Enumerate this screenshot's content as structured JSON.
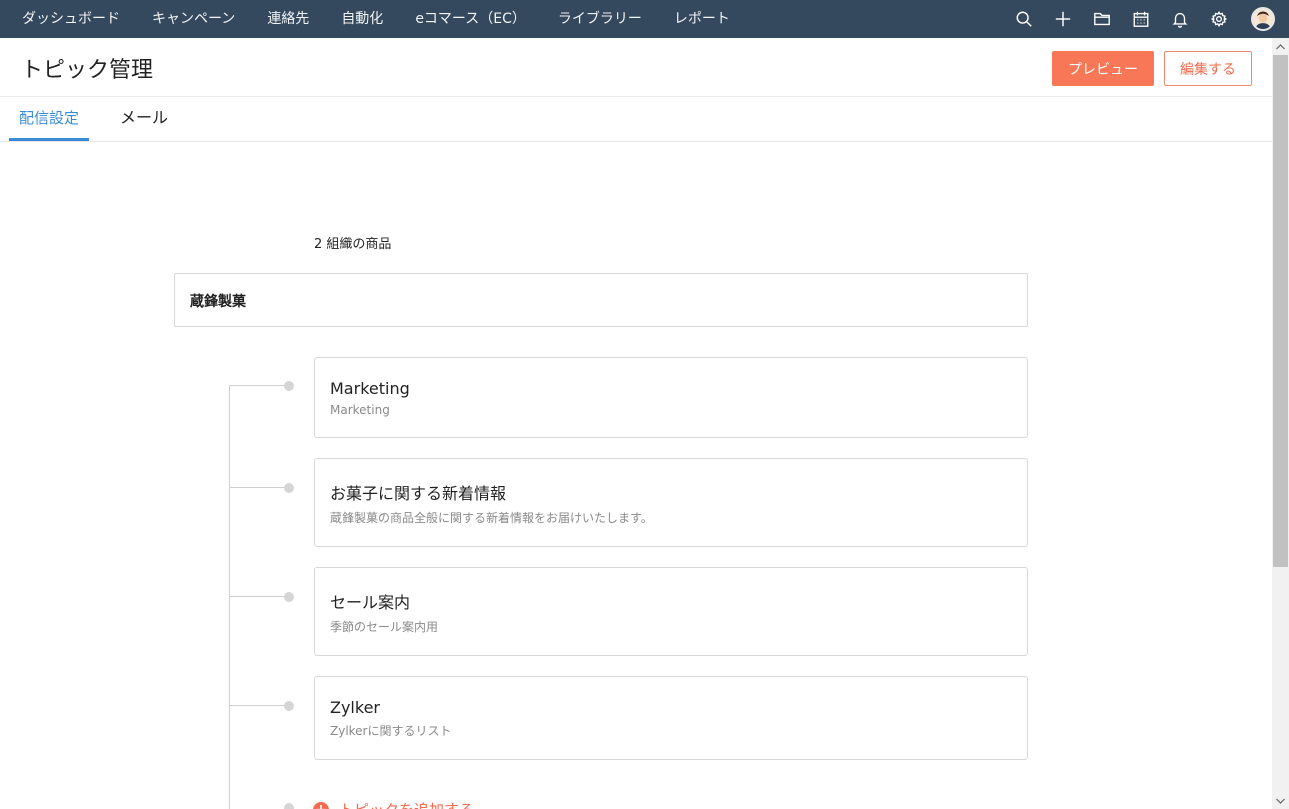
{
  "topnav": {
    "menu": [
      "ダッシュボード",
      "キャンペーン",
      "連絡先",
      "自動化",
      "eコマース（EC）",
      "ライブラリー",
      "レポート"
    ],
    "icons": [
      "search-icon",
      "plus-icon",
      "folder-icon",
      "calendar-icon",
      "bell-icon",
      "gear-icon"
    ]
  },
  "header": {
    "title": "トピック管理",
    "preview_label": "プレビュー",
    "edit_label": "編集する"
  },
  "tabs": [
    "配信設定",
    "メール"
  ],
  "content": {
    "org_count": "2 組織の商品",
    "org_name": "蔵鋒製菓",
    "topics": [
      {
        "name": "Marketing",
        "desc": "Marketing"
      },
      {
        "name": "お菓子に関する新着情報",
        "desc": "蔵鋒製菓の商品全般に関する新着情報をお届けいたします。"
      },
      {
        "name": "セール案内",
        "desc": "季節のセール案内用"
      },
      {
        "name": "Zylker",
        "desc": "Zylkerに関するリスト"
      }
    ],
    "add_topic_label": "トピックを追加する"
  },
  "colors": {
    "nav_bg": "#34495e",
    "accent": "#f87757",
    "tab_active": "#3a8bd6"
  }
}
